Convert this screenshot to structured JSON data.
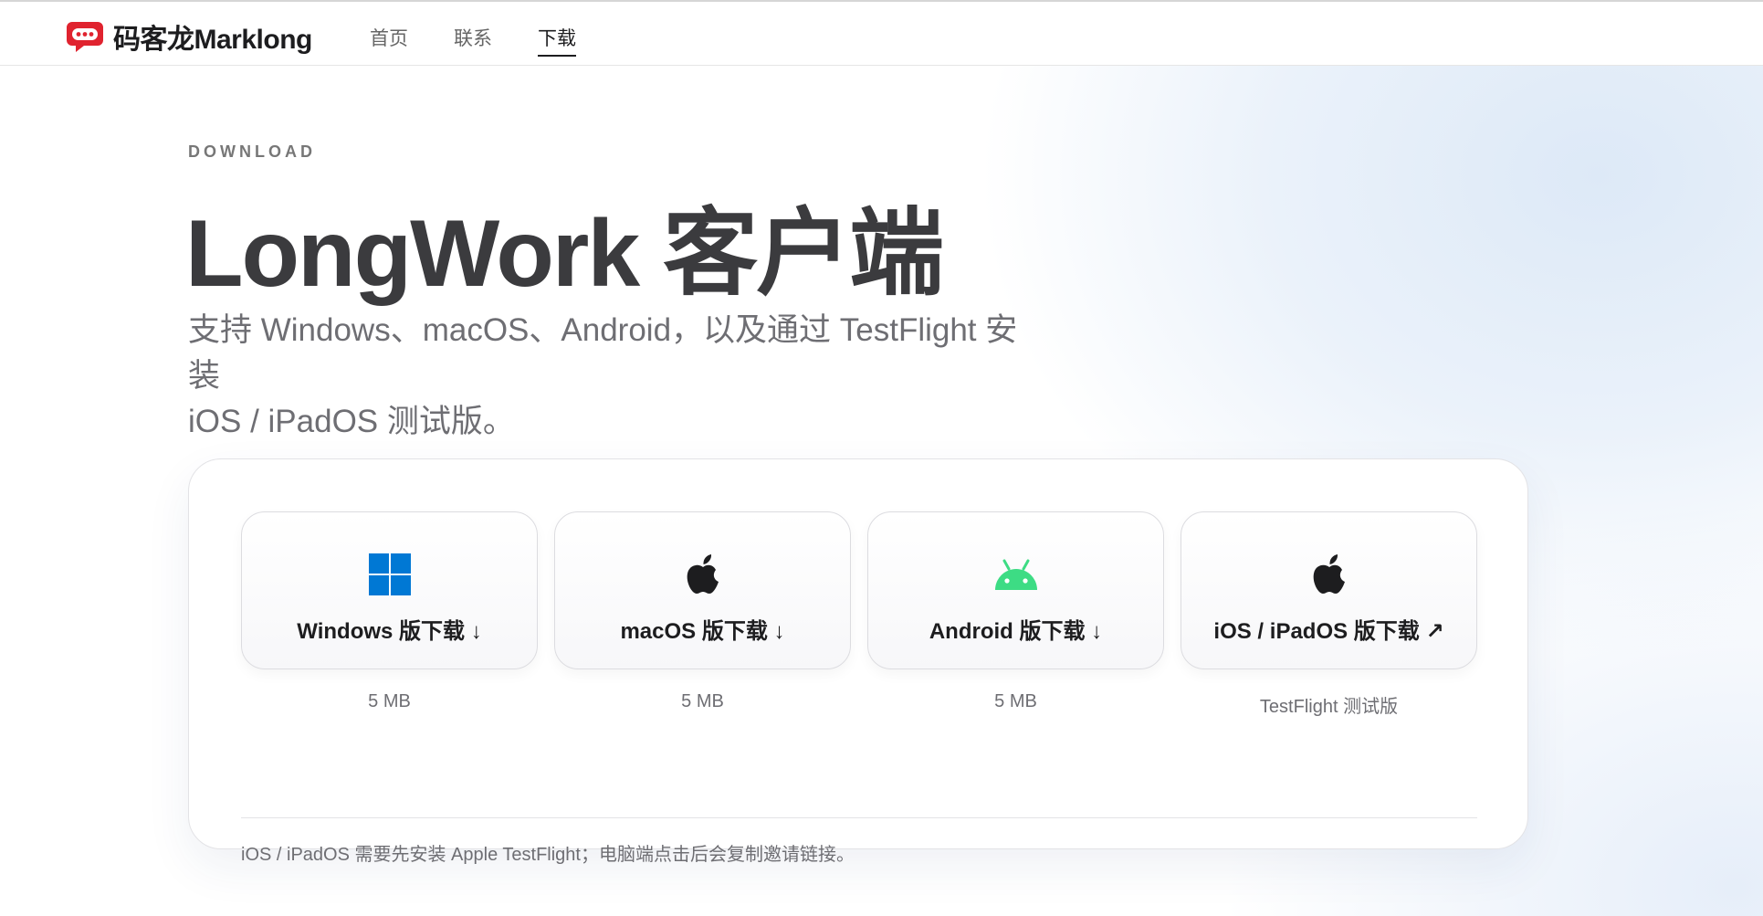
{
  "header": {
    "brand": "码客龙Marklong",
    "nav": [
      {
        "label": "首页",
        "active": false
      },
      {
        "label": "联系",
        "active": false
      },
      {
        "label": "下载",
        "active": true
      }
    ]
  },
  "hero": {
    "eyebrow": "DOWNLOAD",
    "title": "LongWork 客户端",
    "subtitle_line1": "支持 Windows、macOS、Android，以及通过 TestFlight 安装",
    "subtitle_line2": "iOS / iPadOS 测试版。"
  },
  "downloads": [
    {
      "platform": "windows",
      "icon": "windows-icon",
      "label": "Windows 版下载 ↓",
      "meta": "5 MB",
      "icon_color": "#0078d4"
    },
    {
      "platform": "macos",
      "icon": "apple-icon",
      "label": "macOS 版下载 ↓",
      "meta": "5 MB",
      "icon_color": "#1d1d1f"
    },
    {
      "platform": "android",
      "icon": "android-icon",
      "label": "Android 版下载 ↓",
      "meta": "5 MB",
      "icon_color": "#3ddc84"
    },
    {
      "platform": "ios",
      "icon": "apple-icon",
      "label": "iOS / iPadOS 版下载 ↗",
      "meta": "TestFlight 测试版",
      "icon_color": "#1d1d1f"
    }
  ],
  "note": "iOS / iPadOS 需要先安装 Apple TestFlight；电脑端点击后会复制邀请链接。",
  "colors": {
    "brand": "#e0232f",
    "windows": "#0078d4",
    "android": "#3ddc84",
    "text": "#1d1d1f",
    "muted": "#6e6e73"
  }
}
